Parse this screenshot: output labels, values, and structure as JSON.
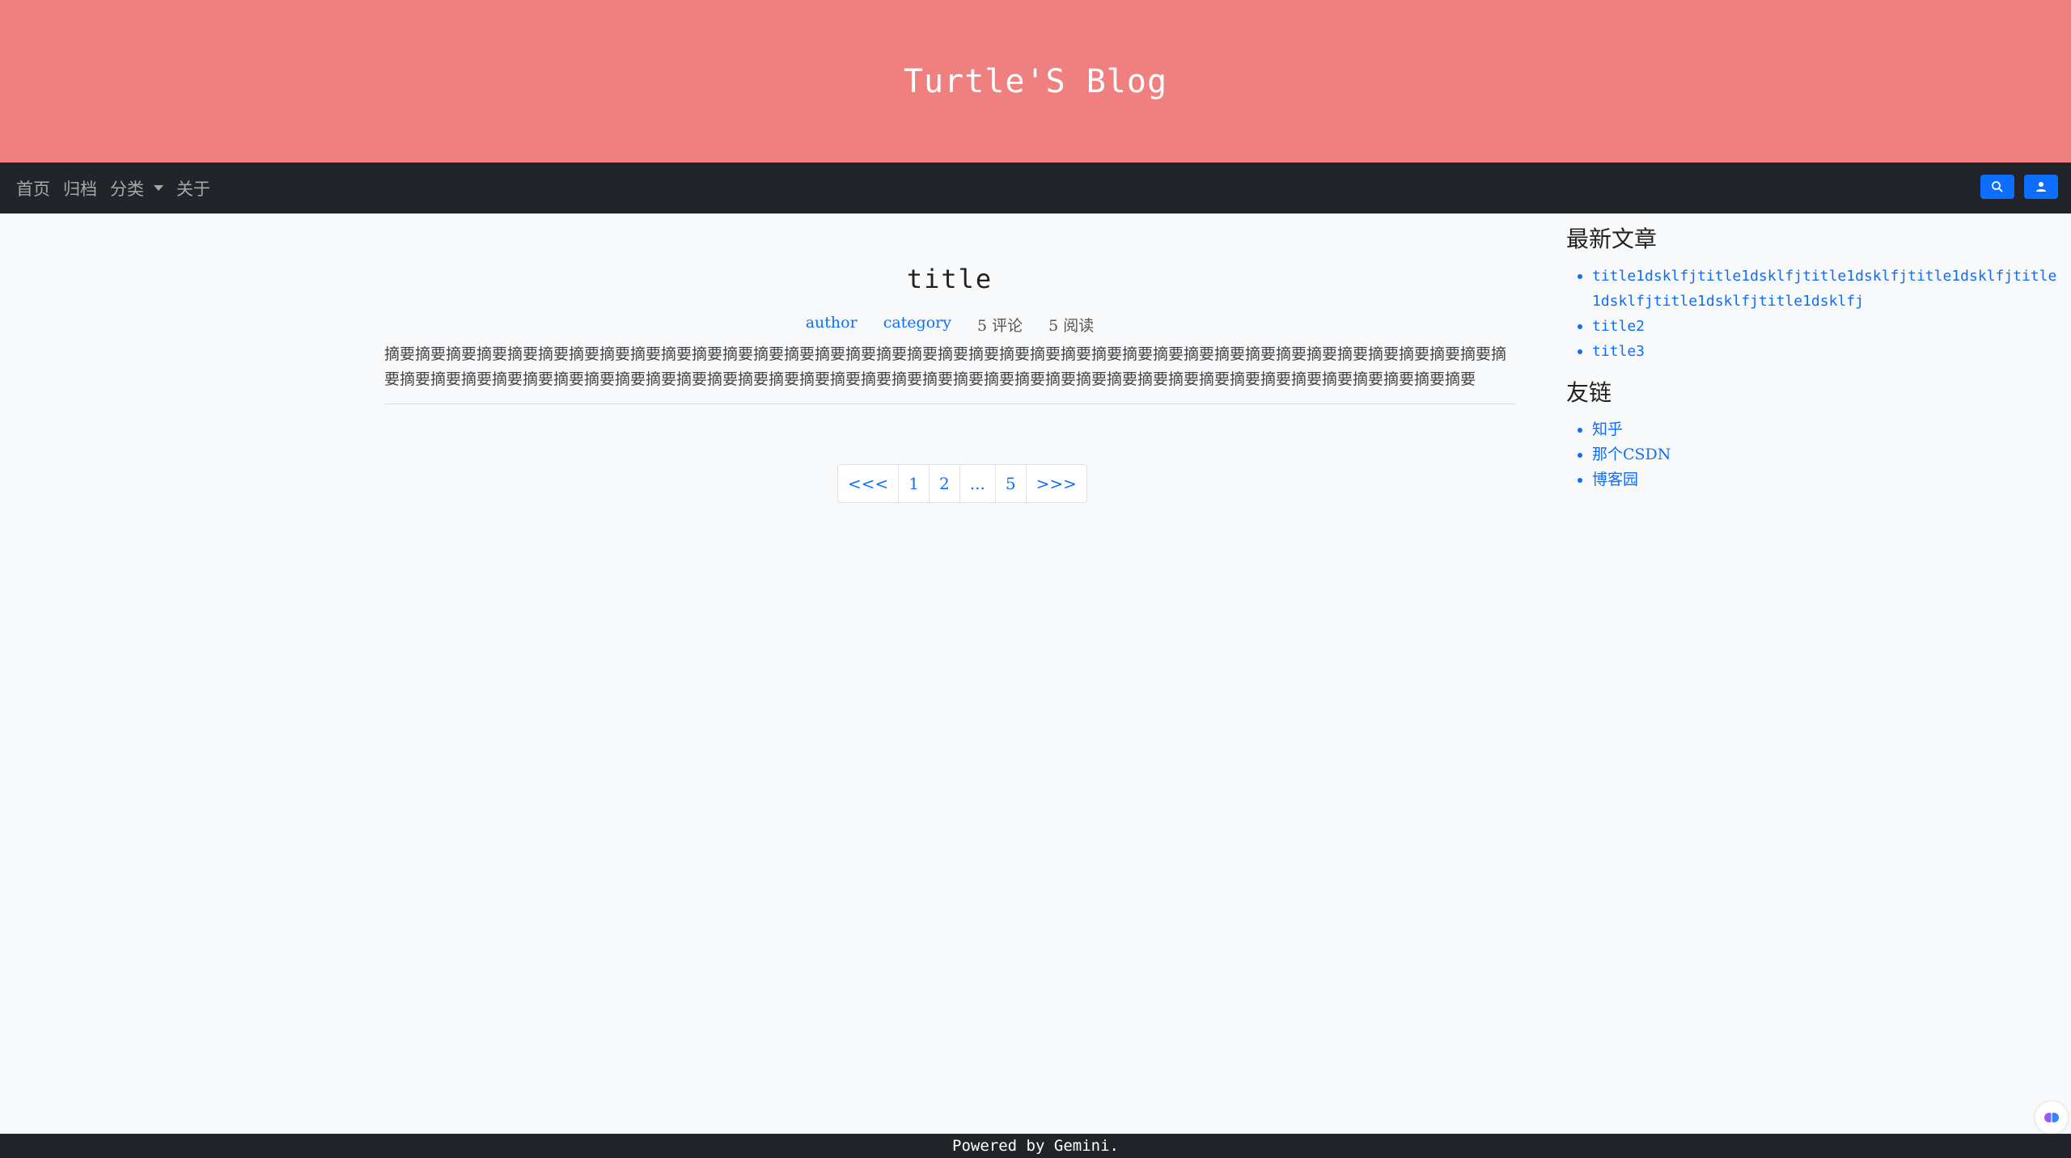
{
  "header": {
    "title": "Turtle'S Blog"
  },
  "nav": {
    "items": [
      {
        "label": "首页"
      },
      {
        "label": "归档"
      },
      {
        "label": "分类"
      },
      {
        "label": "关于"
      }
    ],
    "search_icon": "search-icon",
    "user_icon": "user-icon"
  },
  "post": {
    "title": "title",
    "author": "author",
    "category": "category",
    "comments": "5 评论",
    "reads": "5 阅读",
    "summary": "摘要摘要摘要摘要摘要摘要摘要摘要摘要摘要摘要摘要摘要摘要摘要摘要摘要摘要摘要摘要摘要摘要摘要摘要摘要摘要摘要摘要摘要摘要摘要摘要摘要摘要摘要摘要摘要摘要摘要摘要摘要摘要摘要摘要摘要摘要摘要摘要摘要摘要摘要摘要摘要摘要摘要摘要摘要摘要摘要摘要摘要摘要摘要摘要摘要摘要摘要摘要摘要摘要摘要摘要"
  },
  "pagination": {
    "prev": "<<<",
    "pages": [
      "1",
      "2",
      "...",
      "5"
    ],
    "next": ">>>"
  },
  "sidebar": {
    "latest_heading": "最新文章",
    "latest": [
      "title1dsklfjtitle1dsklfjtitle1dsklfjtitle1dsklfjtitle1dsklfjtitle1dsklfjtitle1dsklfj",
      "title2",
      "title3"
    ],
    "links_heading": "友链",
    "links": [
      "知乎",
      "那个CSDN",
      "博客园"
    ]
  },
  "footer": {
    "text": "Powered by Gemini."
  },
  "colors": {
    "banner": "#f08080",
    "navbar": "#212529",
    "accent": "#0d6efd"
  }
}
